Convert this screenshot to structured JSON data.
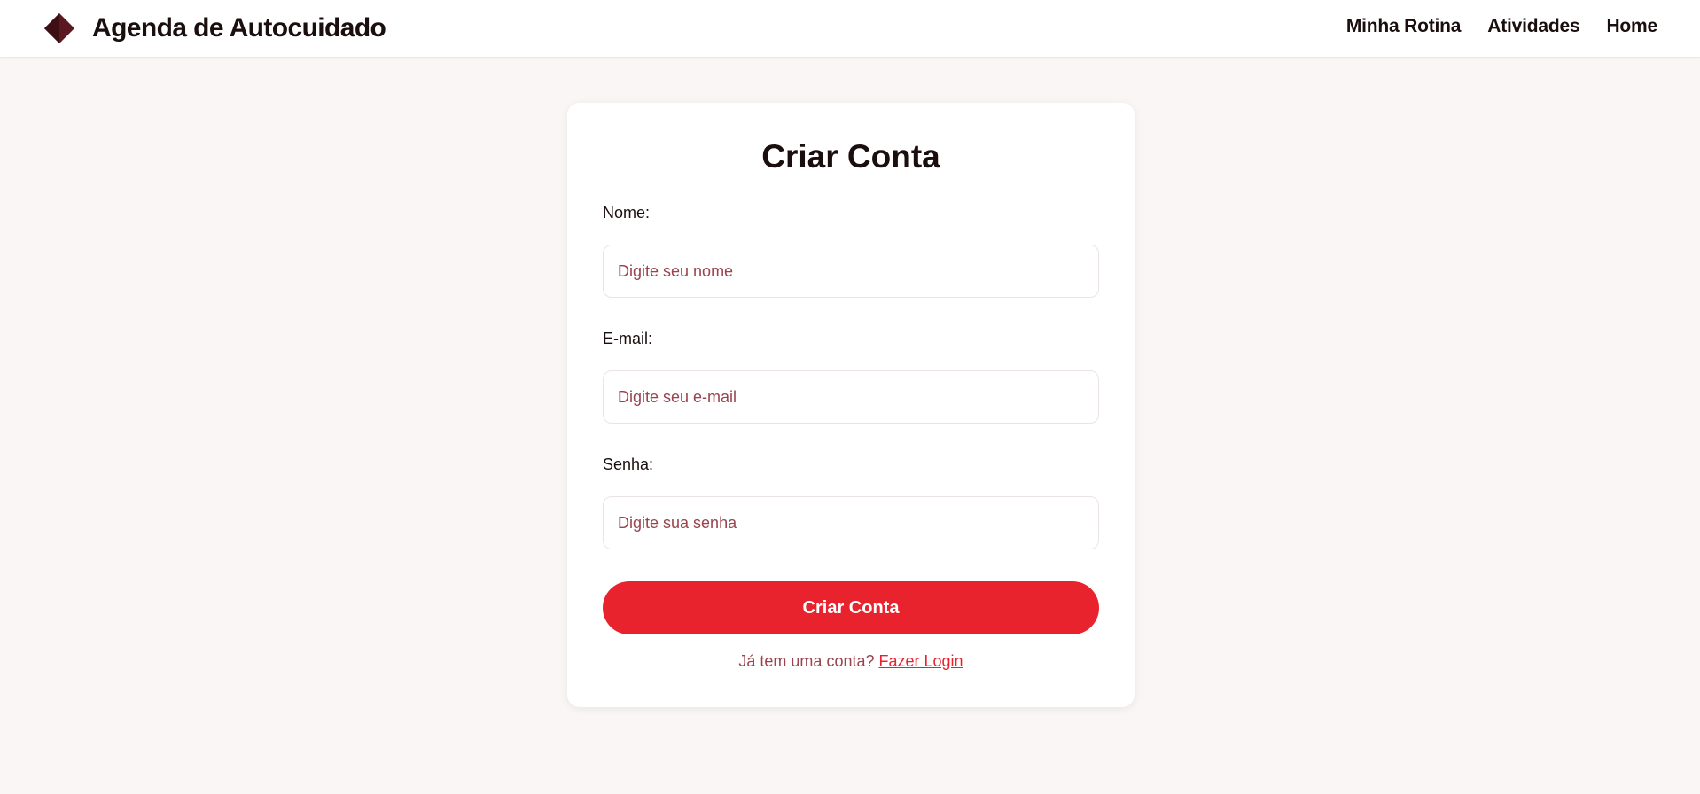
{
  "header": {
    "logo_icon": "diamond-logo-icon",
    "title": "Agenda de Autocuidado",
    "nav": [
      {
        "label": "Minha Rotina"
      },
      {
        "label": "Atividades"
      },
      {
        "label": "Home"
      }
    ]
  },
  "form": {
    "title": "Criar Conta",
    "fields": [
      {
        "label": "Nome:",
        "value": "",
        "placeholder": "Digite seu nome"
      },
      {
        "label": "E-mail:",
        "value": "",
        "placeholder": "Digite seu e-mail"
      },
      {
        "label": "Senha:",
        "value": "",
        "placeholder": "Digite sua senha"
      }
    ],
    "submit_label": "Criar Conta",
    "login_prompt": "Já tem uma conta?",
    "login_link": "Fazer Login"
  },
  "colors": {
    "accent": "#e8232d",
    "logo": "#5c1820",
    "placeholder": "#99434d",
    "background": "#faf6f5",
    "text": "#1b0e0e"
  }
}
